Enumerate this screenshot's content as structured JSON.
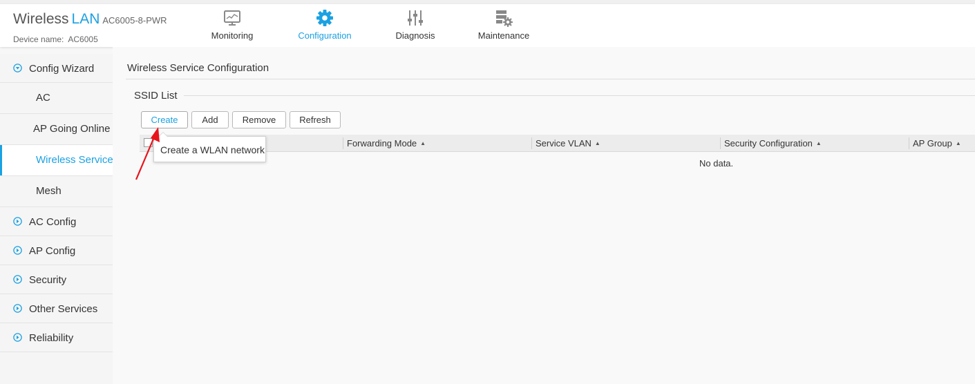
{
  "header": {
    "brand_word1": "Wireless",
    "brand_word2": "LAN",
    "model": "AC6005-8-PWR",
    "device_name_label": "Device name:",
    "device_name_value": "AC6005"
  },
  "nav_tabs": [
    {
      "label": "Monitoring",
      "icon": "monitor-icon",
      "active": false
    },
    {
      "label": "Configuration",
      "icon": "gear-icon",
      "active": true
    },
    {
      "label": "Diagnosis",
      "icon": "sliders-icon",
      "active": false
    },
    {
      "label": "Maintenance",
      "icon": "server-gear-icon",
      "active": false
    }
  ],
  "sidebar": {
    "items": [
      {
        "label": "Config Wizard",
        "icon": "chevron-down-circle-icon",
        "expanded": true
      },
      {
        "label": "AC Config",
        "icon": "chevron-right-circle-icon"
      },
      {
        "label": "AP Config",
        "icon": "chevron-right-circle-icon"
      },
      {
        "label": "Security",
        "icon": "chevron-right-circle-icon"
      },
      {
        "label": "Other Services",
        "icon": "chevron-right-circle-icon"
      },
      {
        "label": "Reliability",
        "icon": "chevron-right-circle-icon"
      }
    ],
    "subitems": [
      {
        "label": "AC"
      },
      {
        "label": "AP Going Online"
      },
      {
        "label": "Wireless Service",
        "active": true
      },
      {
        "label": "Mesh"
      }
    ]
  },
  "main": {
    "page_title": "Wireless Service Configuration",
    "section_title": "SSID List",
    "buttons": {
      "create": "Create",
      "add": "Add",
      "remove": "Remove",
      "refresh": "Refresh"
    },
    "table": {
      "columns": [
        "Forwarding Mode",
        "Service VLAN",
        "Security Configuration",
        "AP Group"
      ],
      "empty_text": "No data."
    },
    "tooltip": "Create a WLAN network"
  },
  "colors": {
    "accent": "#1ba1e2",
    "annotation_arrow": "#e8141c"
  }
}
